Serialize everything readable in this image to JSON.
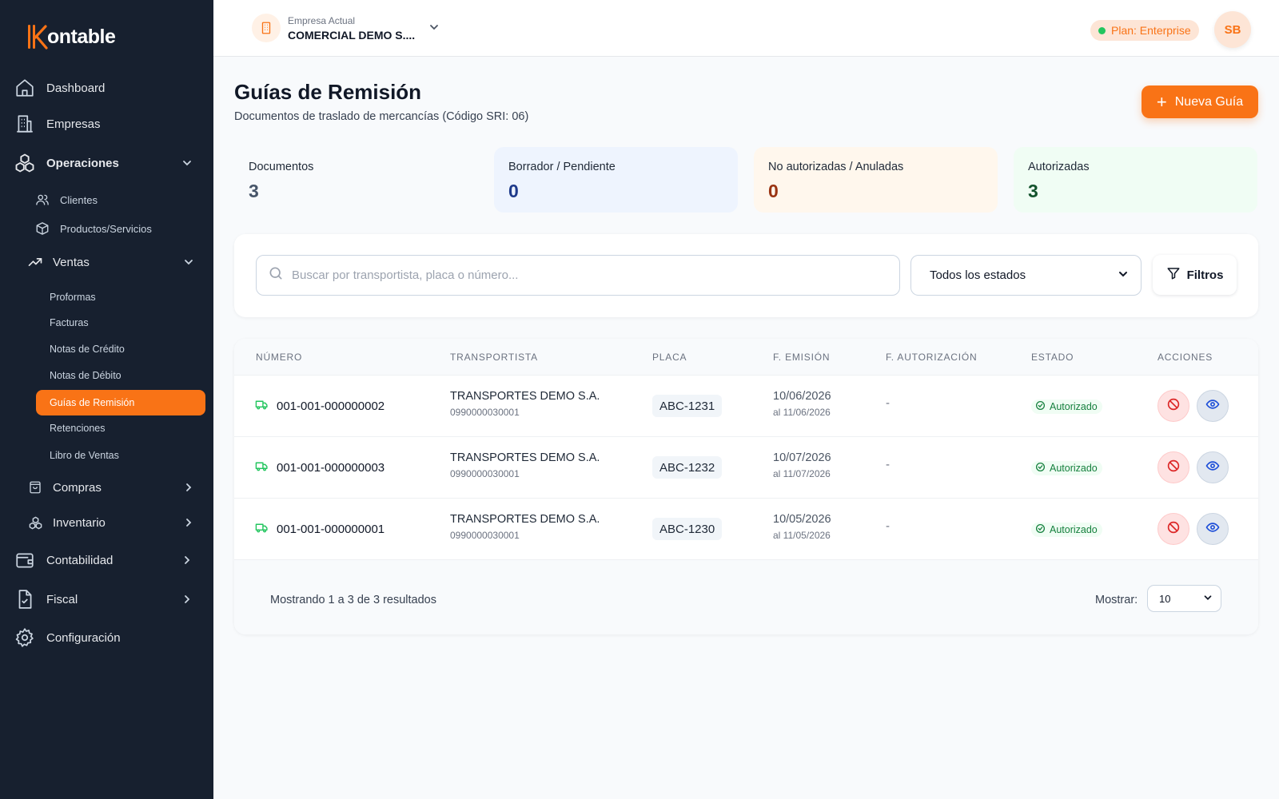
{
  "brand": {
    "logo_text": "ontable",
    "accent": "#f97316",
    "sidebar_bg": "#17202f"
  },
  "sidebar": {
    "items": [
      {
        "label": "Dashboard",
        "icon": "home-icon"
      },
      {
        "label": "Empresas",
        "icon": "building-icon"
      },
      {
        "label": "Operaciones",
        "icon": "boxes-icon",
        "expanded": true
      },
      {
        "label": "Contabilidad",
        "icon": "wallet-icon"
      },
      {
        "label": "Fiscal",
        "icon": "file-check-icon"
      },
      {
        "label": "Configuración",
        "icon": "gear-icon"
      }
    ],
    "operaciones": [
      {
        "label": "Clientes",
        "icon": "users-icon"
      },
      {
        "label": "Productos/Servicios",
        "icon": "package-icon"
      },
      {
        "label": "Ventas",
        "icon": "trending-up-icon",
        "expanded": true
      },
      {
        "label": "Compras",
        "icon": "shopping-bag-icon"
      },
      {
        "label": "Inventario",
        "icon": "boxes-icon"
      }
    ],
    "ventas": [
      {
        "label": "Proformas"
      },
      {
        "label": "Facturas"
      },
      {
        "label": "Notas de Crédito"
      },
      {
        "label": "Notas de Débito"
      },
      {
        "label": "Guías de Remisión",
        "active": true
      },
      {
        "label": "Retenciones"
      },
      {
        "label": "Libro de Ventas"
      }
    ]
  },
  "header": {
    "company_label": "Empresa Actual",
    "company_name": "COMERCIAL DEMO S....",
    "plan": "Plan: Enterprise",
    "avatar": "SB"
  },
  "page": {
    "title": "Guías de Remisión",
    "subtitle": "Documentos de traslado de mercancías (Código SRI: 06)",
    "new_button": "Nueva Guía"
  },
  "stats": [
    {
      "label": "Documentos",
      "value": "3",
      "bg": "#f8fafc",
      "color": "#475569"
    },
    {
      "label": "Borrador / Pendiente",
      "value": "0",
      "bg": "#eef4fe",
      "color": "#1e3a8a"
    },
    {
      "label": "No autorizadas / Anuladas",
      "value": "0",
      "bg": "#fff7ed",
      "color": "#9a3412"
    },
    {
      "label": "Autorizadas",
      "value": "3",
      "bg": "#f0fdf4",
      "color": "#14532d"
    }
  ],
  "search": {
    "placeholder": "Buscar por transportista, placa o número...",
    "value": "",
    "status_selected": "Todos los estados",
    "filters_label": "Filtros"
  },
  "table": {
    "columns": [
      "NÚMERO",
      "TRANSPORTISTA",
      "PLACA",
      "F. EMISIÓN",
      "F. AUTORIZACIÓN",
      "ESTADO",
      "ACCIONES"
    ],
    "rows": [
      {
        "numero": "001-001-000000002",
        "transportista": "TRANSPORTES DEMO S.A.",
        "ruc": "0990000030001",
        "placa": "ABC-1231",
        "emision": "10/06/2026",
        "hasta": "al 11/06/2026",
        "autorizacion": "-",
        "estado": "Autorizado"
      },
      {
        "numero": "001-001-000000003",
        "transportista": "TRANSPORTES DEMO S.A.",
        "ruc": "0990000030001",
        "placa": "ABC-1232",
        "emision": "10/07/2026",
        "hasta": "al 11/07/2026",
        "autorizacion": "-",
        "estado": "Autorizado"
      },
      {
        "numero": "001-001-000000001",
        "transportista": "TRANSPORTES DEMO S.A.",
        "ruc": "0990000030001",
        "placa": "ABC-1230",
        "emision": "10/05/2026",
        "hasta": "al 11/05/2026",
        "autorizacion": "-",
        "estado": "Autorizado"
      }
    ],
    "showing": "Mostrando 1 a 3 de 3 resultados",
    "show_label": "Mostrar:",
    "per_page": "10"
  }
}
